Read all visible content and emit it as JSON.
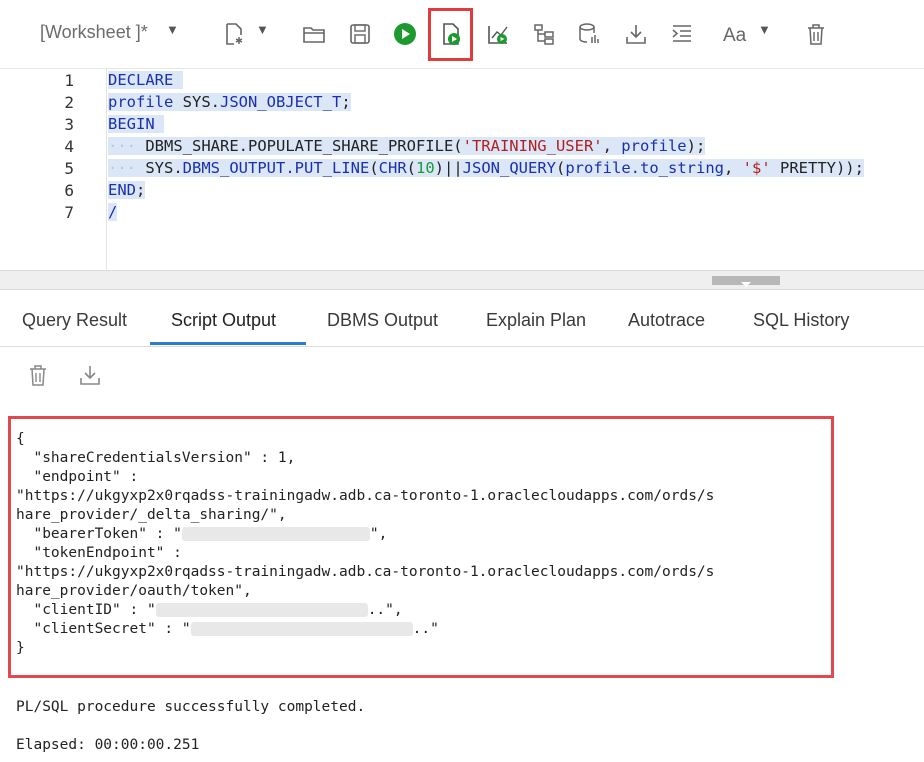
{
  "toolbar": {
    "worksheet_label": "[Worksheet ]*",
    "icons": [
      "new-file-icon",
      "open-folder-icon",
      "save-icon",
      "run-statement-icon",
      "run-script-icon",
      "explain-plan-icon",
      "autotrace-icon",
      "sql-history-icon",
      "download-icon",
      "format-icon",
      "font-case-icon",
      "trash-icon"
    ]
  },
  "editor": {
    "line_numbers": [
      "1",
      "2",
      "3",
      "4",
      "5",
      "6",
      "7"
    ],
    "lines": {
      "l1_kw": "DECLARE",
      "l2_a": "profile ",
      "l2_b": "SYS.",
      "l2_c": "JSON_OBJECT_T",
      "l2_d": ";",
      "l3_kw": "BEGIN",
      "l4_a": "DBMS_SHARE.POPULATE_SHARE_PROFILE(",
      "l4_str": "'TRAINING_USER'",
      "l4_b": ", ",
      "l4_c": "profile",
      "l4_d": ");",
      "l5_a": "SYS.",
      "l5_b": "DBMS_OUTPUT.PUT_LINE",
      "l5_c": "(",
      "l5_d": "CHR",
      "l5_e": "(",
      "l5_num": "10",
      "l5_f": ")||",
      "l5_g": "JSON_QUERY",
      "l5_h": "(",
      "l5_i": "profile.to_string",
      "l5_j": ", ",
      "l5_str": "'$'",
      "l5_k": " PRETTY));",
      "l6_kw": "END",
      "l6_a": ";",
      "l7": "/"
    }
  },
  "tabs": [
    "Query Result",
    "Script Output",
    "DBMS Output",
    "Explain Plan",
    "Autotrace",
    "SQL History"
  ],
  "output": {
    "json_lines": {
      "open": "{",
      "version": "  \"shareCredentialsVersion\" : 1,",
      "endpoint_key": "  \"endpoint\" :",
      "endpoint_val1": "\"https://ukgyxp2x0rqadss-trainingadw.adb.ca-toronto-1.oraclecloudapps.com/ords/s",
      "endpoint_val2": "hare_provider/_delta_sharing/\",",
      "bearer_a": "  \"bearerToken\" : \"",
      "bearer_b": "\",",
      "token_key": "  \"tokenEndpoint\" :",
      "token_val1": "\"https://ukgyxp2x0rqadss-trainingadw.adb.ca-toronto-1.oraclecloudapps.com/ords/s",
      "token_val2": "hare_provider/oauth/token\",",
      "client_a": "  \"clientID\" : \"",
      "client_b": "..\",",
      "secret_a": "  \"clientSecret\" : \"",
      "secret_b": "..\"",
      "close": "}"
    },
    "completed": "PL/SQL procedure successfully completed.",
    "elapsed": "Elapsed: 00:00:00.251"
  }
}
